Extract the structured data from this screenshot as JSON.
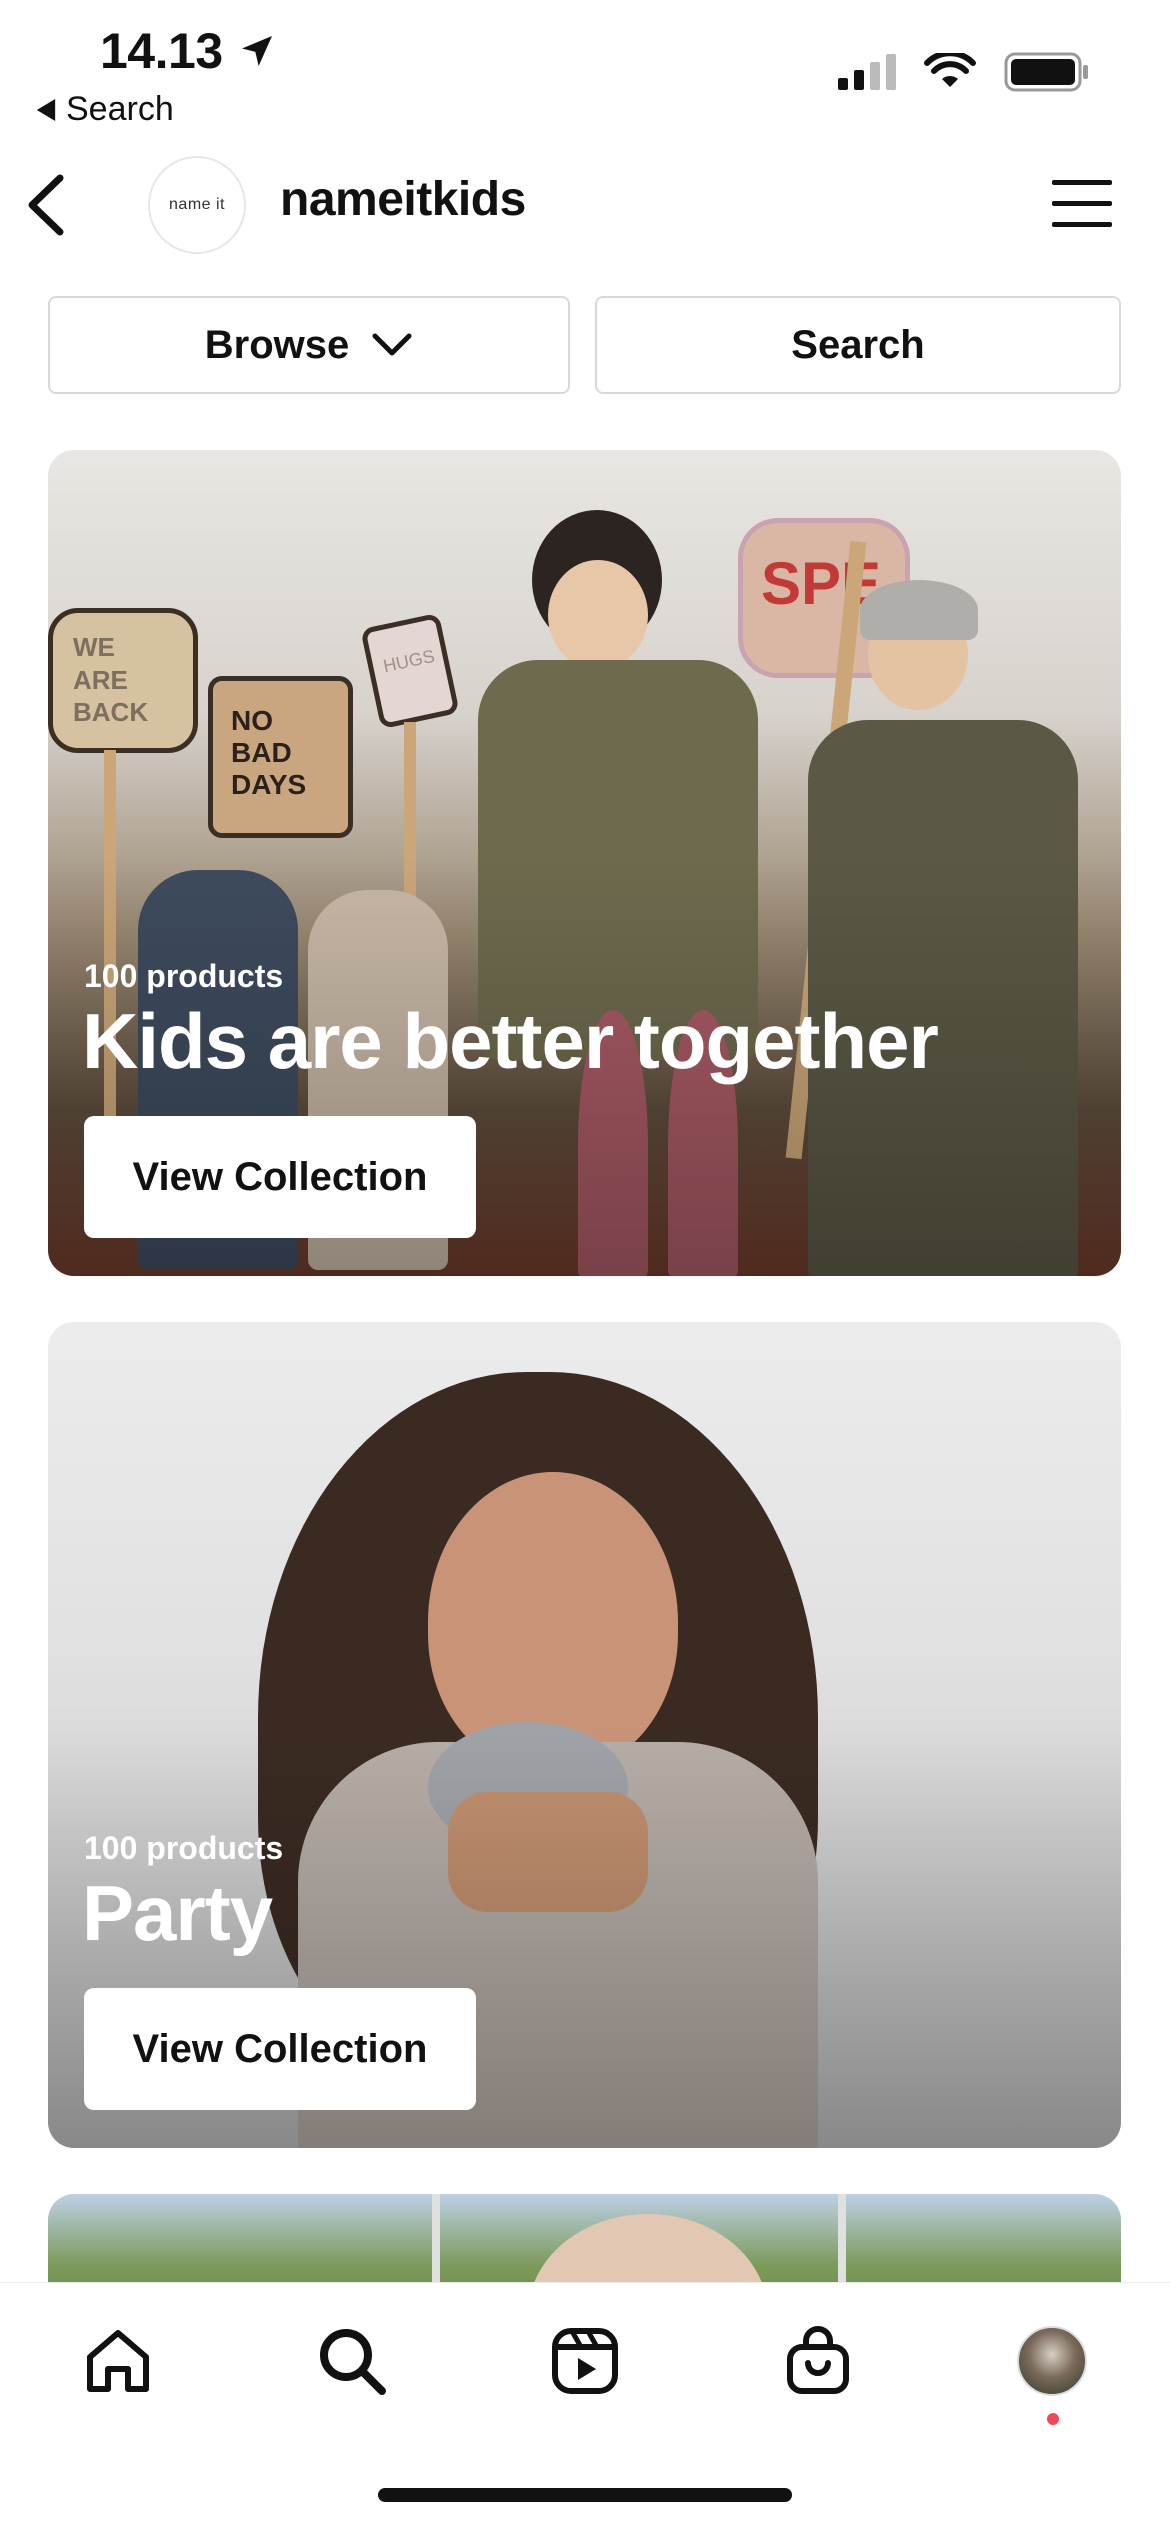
{
  "status_bar": {
    "time": "14.13",
    "back_label": "Search"
  },
  "header": {
    "account_name": "nameitkids",
    "logo_text": "name it"
  },
  "actions": {
    "browse_label": "Browse",
    "search_label": "Search"
  },
  "collections": [
    {
      "count": "100 products",
      "title": "Kids are better together",
      "button": "View Collection",
      "sign_texts": [
        "WE ARE BACK",
        "NO BAD DAYS",
        "HUGS",
        "SPE"
      ]
    },
    {
      "count": "100 products",
      "title": "Party",
      "button": "View Collection"
    }
  ],
  "bottom_nav": {
    "items": [
      "home-icon",
      "search-icon",
      "reels-icon",
      "shop-icon",
      "profile-avatar"
    ],
    "notification_color": "#ed4956"
  }
}
